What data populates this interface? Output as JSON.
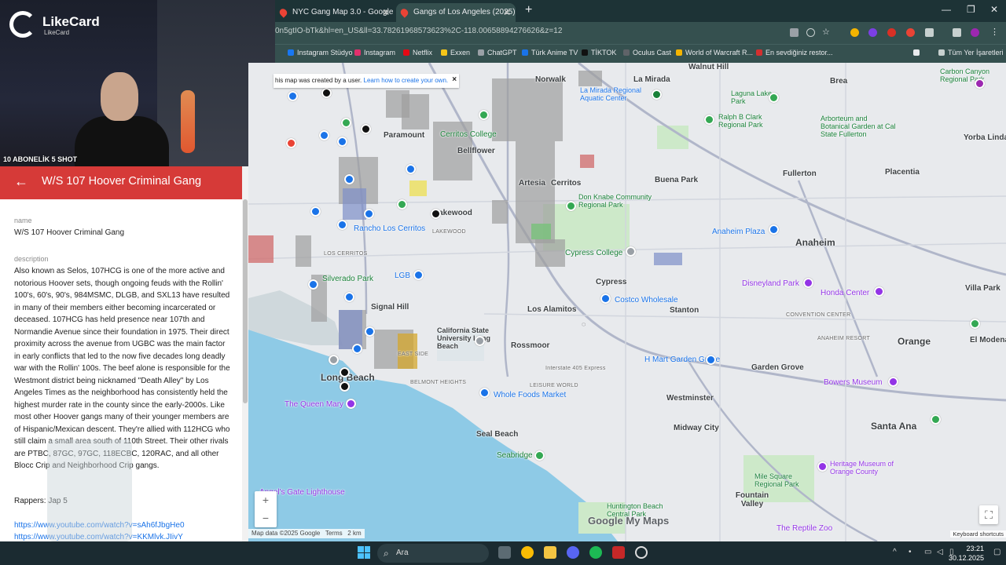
{
  "browser": {
    "tabs": [
      {
        "title": "NYC Gang Map 3.0 - Google M",
        "active": false
      },
      {
        "title": "Gangs of Los Angeles (2025) - G",
        "active": true
      }
    ],
    "url": "0n5gtIO-bTk&hl=en_US&ll=33.78261968573623%2C-118.00658894276626&z=12",
    "bookmarks": [
      "Instagram Stüdyo",
      "Instagram",
      "Netflix",
      "Exxen",
      "ChatGPT",
      "Türk Anime TV",
      "TİKTOK",
      "Oculus Cast",
      "World of Warcraft R...",
      "En sevdiğiniz restor..."
    ],
    "all_bookmarks": "Tüm Yer İşaretleri",
    "bookmark_colors": [
      "#1877f2",
      "#e1306c",
      "#e50914",
      "#f5c518",
      "#9aa0a6",
      "#1a73e8",
      "#111111",
      "#5f6368",
      "#f4b400",
      "#d32f2f"
    ]
  },
  "stream": {
    "logo_text": "LikeCard",
    "logo_sub": "LikeCard",
    "overlay_text": "10 ABONELİK 5 SHOT"
  },
  "panel": {
    "title": "W/S 107 Hoover Criminal Gang",
    "name_label": "name",
    "name_value": "W/S 107 Hoover Criminal Gang",
    "description_label": "description",
    "description": "Also known as Selos, 107HCG is one of the more active and notorious Hoover sets, though ongoing feuds with the Rollin' 100's, 60's, 90's, 984MSMC, DLGB, and SXL13 have resulted in many of their members either becoming incarcerated or deceased. 107HCG has held presence near 107th and Normandie Avenue since their foundation in 1975. Their direct proximity across the avenue from UGBC was the main factor in early conflicts that led to the now five decades long deadly war with the Rollin' 100s. The beef alone is responsible for the Westmont district being nicknamed \"Death Alley\" by Los Angeles Times as the neighborhood has consistently held the highest murder rate in the county since the early-2000s. Like most other Hoover gangs many of their younger members are of Hispanic/Mexican descent. They're allied with 112HCG who still claim a small area south of 110th Street. Their other rivals are PTBC, 87GC, 97GC, 118ECBC, 120RAC, and all other Blocc Crip and Neighborhood Crip gangs.",
    "rappers": "Rappers: Jap 5",
    "links": [
      "https://www.youtube.com/watch?v=sAh6fJbgHe0",
      "https://www.youtube.com/watch?v=KKMlvk.JIivY"
    ]
  },
  "map": {
    "note_text": "his map was created by a user.",
    "note_link": "Learn how to create your own.",
    "labels": [
      {
        "t": "Norwalk",
        "c": "bold"
      },
      {
        "t": "La Mirada",
        "c": "bold"
      },
      {
        "t": "Brea",
        "c": "bold"
      },
      {
        "t": "Paramount",
        "c": "bold"
      },
      {
        "t": "Bellflower",
        "c": "bold"
      },
      {
        "t": "Cerritos College",
        "c": "green"
      },
      {
        "t": "Artesia",
        "c": "bold"
      },
      {
        "t": "Cerritos",
        "c": "bold"
      },
      {
        "t": "Buena Park",
        "c": "bold"
      },
      {
        "t": "Fullerton",
        "c": "bold"
      },
      {
        "t": "Placentia",
        "c": "bold"
      },
      {
        "t": "Yorba Linda",
        "c": "bold"
      },
      {
        "t": "Lakewood",
        "c": "bold"
      },
      {
        "t": "Rancho Los Cerritos",
        "c": "blue"
      },
      {
        "t": "LOS CERRITOS",
        "c": "small"
      },
      {
        "t": "LAKEWOOD",
        "c": "small"
      },
      {
        "t": "Cypress College",
        "c": "green"
      },
      {
        "t": "Anaheim Plaza",
        "c": "blue"
      },
      {
        "t": "Anaheim",
        "c": "big"
      },
      {
        "t": "Disneyland Park",
        "c": "purple"
      },
      {
        "t": "Villa Park",
        "c": "bold"
      },
      {
        "t": "Cypress",
        "c": "bold"
      },
      {
        "t": "Costco Wholesale",
        "c": "blue"
      },
      {
        "t": "Honda Center",
        "c": "purple"
      },
      {
        "t": "Silverado Park",
        "c": "green"
      },
      {
        "t": "LGB",
        "c": "blue"
      },
      {
        "t": "Signal Hill",
        "c": "bold"
      },
      {
        "t": "Los Alamitos",
        "c": "bold"
      },
      {
        "t": "Stanton",
        "c": "bold"
      },
      {
        "t": "CONVENTION CENTER",
        "c": "small"
      },
      {
        "t": "ANAHEIM RESORT",
        "c": "small"
      },
      {
        "t": "Orange",
        "c": "big"
      },
      {
        "t": "El Modena",
        "c": "bold"
      },
      {
        "t": "California State University Long Beach",
        "c": "bold"
      },
      {
        "t": "Rossmoor",
        "c": "bold"
      },
      {
        "t": "H Mart Garden Grove",
        "c": "blue"
      },
      {
        "t": "Garden Grove",
        "c": "bold"
      },
      {
        "t": "Bowers Museum",
        "c": "purple"
      },
      {
        "t": "Long Beach",
        "c": "big"
      },
      {
        "t": "EAST SIDE",
        "c": "small"
      },
      {
        "t": "BELMONT HEIGHTS",
        "c": "small"
      },
      {
        "t": "LEISURE WORLD",
        "c": "small"
      },
      {
        "t": "Whole Foods Market",
        "c": "blue"
      },
      {
        "t": "Westminster",
        "c": "bold"
      },
      {
        "t": "The Queen Mary",
        "c": "purple"
      },
      {
        "t": "Seal Beach",
        "c": "bold"
      },
      {
        "t": "Midway City",
        "c": "bold"
      },
      {
        "t": "Santa Ana",
        "c": "big"
      },
      {
        "t": "Seabridge Pk",
        "c": "green"
      },
      {
        "t": "Mile Square Regional Park",
        "c": "green"
      },
      {
        "t": "Heritage Museum of Orange County",
        "c": "purple"
      },
      {
        "t": "Fountain Valley",
        "c": "bold"
      },
      {
        "t": "Angel's Gate Lighthouse",
        "c": "purple"
      },
      {
        "t": "Huntington Beach Central Park",
        "c": "green"
      },
      {
        "t": "Arborteum and Botanical Garden at Cal State Fullerton",
        "c": "green"
      },
      {
        "t": "Ralph B Clark Regional Park",
        "c": "green"
      },
      {
        "t": "Laguna Lake Park",
        "c": "green"
      },
      {
        "t": "La Mirada Regional Aquatic Center",
        "c": "blue"
      },
      {
        "t": "Don Knabe Community Regional Park",
        "c": "green"
      },
      {
        "t": "Interstate 405 Express",
        "c": "small"
      },
      {
        "t": "The Reptile Zoo",
        "c": "purple"
      },
      {
        "t": "Carbon Canyon Regional Park",
        "c": "green"
      },
      {
        "t": "Walnut Hill",
        "c": "bold"
      }
    ],
    "zoom_in": "+",
    "zoom_out": "−",
    "footer_data": "Map data ©2025 Google",
    "footer_terms": "Terms",
    "footer_scale": "2 km",
    "keyboard": "Keyboard shortcuts",
    "logo": "Google My Maps"
  },
  "taskbar": {
    "search": "Ara",
    "time": "23:21",
    "date": "30.12.2025"
  }
}
